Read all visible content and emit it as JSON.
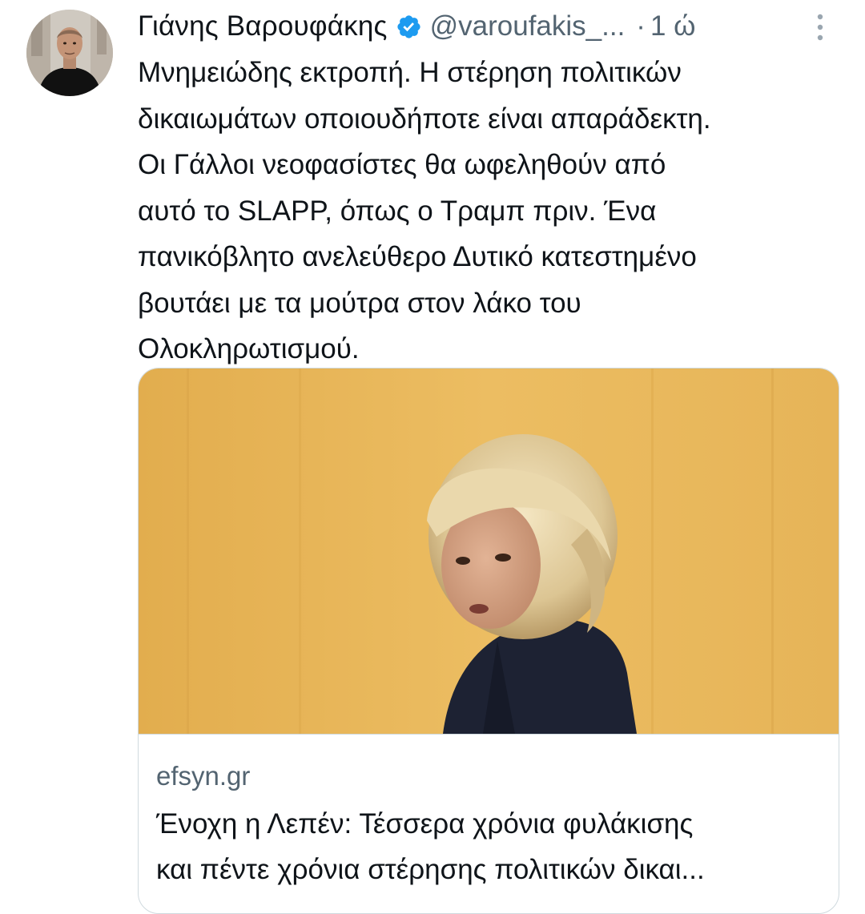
{
  "author": {
    "display_name": "Γιάνης Βαρουφάκης",
    "handle": "@varoufakis_...",
    "separator": "·",
    "time": "1 ώ",
    "avatar_icon": "profile-photo",
    "verified_icon": "verified-badge-icon"
  },
  "tweet": {
    "lines": [
      "Μνημειώδης εκτροπή. Η στέρηση πολιτικών",
      "δικαιωμάτων οποιουδήποτε είναι απαράδεκτη.",
      "Οι Γάλλοι νεοφασίστες θα ωφεληθούν από",
      "αυτό το SLAPP, όπως ο Τραμπ πριν. Ένα",
      "πανικόβλητο ανελεύθερο Δυτικό κατεστημένο",
      "βουτάει με τα μούτρα στον λάκο του",
      "Ολοκληρωτισμού."
    ]
  },
  "card": {
    "domain": "efsyn.gr",
    "title_lines": [
      "Ένοχη η Λεπέν: Τέσσερα χρόνια φυλάκισης",
      "και πέντε χρόνια στέρησης πολιτικών δικαι..."
    ]
  },
  "colors": {
    "text_primary": "#0f1419",
    "text_secondary": "#536471",
    "verified_blue": "#1d9bf0",
    "border": "#cfd9de",
    "card_background": "#e9b85a"
  }
}
